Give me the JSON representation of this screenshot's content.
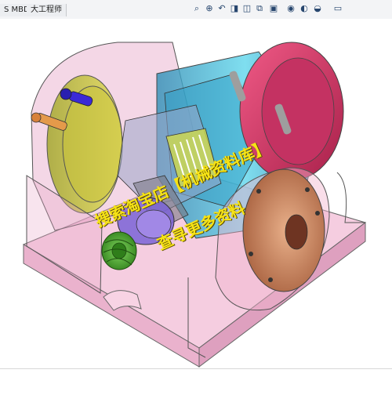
{
  "tabs": [
    {
      "label": "S MBD"
    },
    {
      "label": "大工程师"
    }
  ],
  "toolbar_icons": [
    "zoom-to-fit-icon",
    "zoom-to-area-icon",
    "previous-view-icon",
    "section-view-icon",
    "dynamic-annotation-icon",
    "view-orientation-icon",
    "display-style-icon",
    "hide-show-items-icon",
    "edit-appearance-icon",
    "apply-scene-icon",
    "view-settings-icon"
  ],
  "watermark": {
    "line1": "搜索淘宝店【机械资料库】",
    "line2": "查寻更多资料"
  },
  "colors": {
    "toolbar_bg": "#f3f4f6",
    "transparent_housing": "#e7a7c7",
    "base_plate": "#f0b8d2",
    "flange_red": "#d93a6a",
    "cyan_body": "#49c5df",
    "green_gear": "#42a42a",
    "bronze_flange": "#c98360",
    "purple_part": "#6b5bd3",
    "yellow_flange": "#d6cf38",
    "watermark": "#f6e315"
  }
}
